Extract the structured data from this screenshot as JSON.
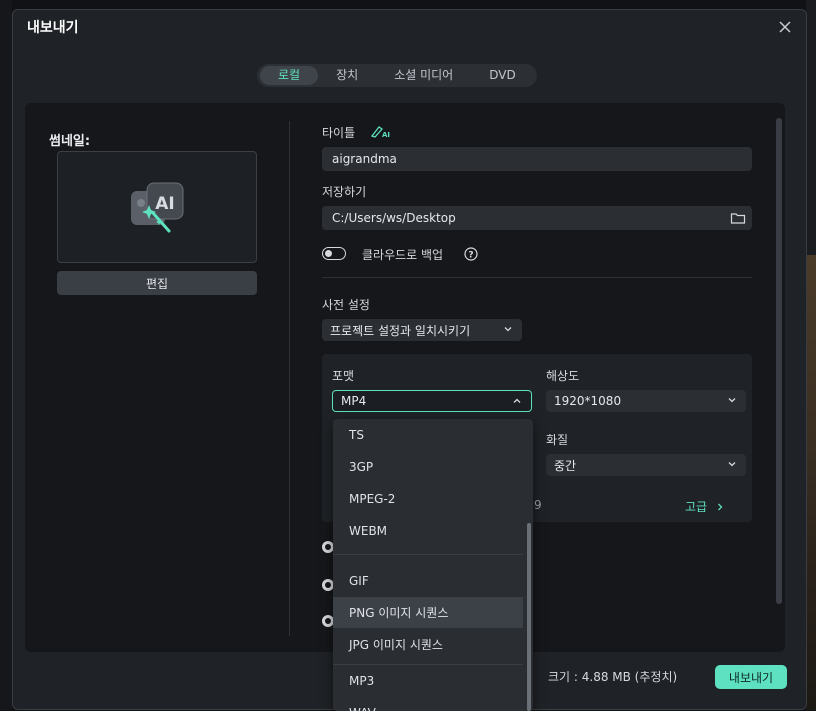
{
  "dialog": {
    "title": "내보내기"
  },
  "tabs": [
    {
      "label": "로컬",
      "active": true
    },
    {
      "label": "장치",
      "active": false
    },
    {
      "label": "소셜 미디어",
      "active": false
    },
    {
      "label": "DVD",
      "active": false
    }
  ],
  "thumbnail": {
    "label": "썸네일:",
    "edit_label": "편집",
    "icon": "ai-image-icon"
  },
  "form": {
    "title_label": "타이틀",
    "title_value": "aigrandma",
    "save_label": "저장하기",
    "save_path": "C:/Users/ws/Desktop",
    "cloud_backup_label": "클라우드로 백업",
    "cloud_backup_on": false,
    "preset_label": "사전 설정",
    "preset_value": "프로젝트 설정과 일치시키기",
    "format_label": "포맷",
    "format_value": "MP4",
    "resolution_label": "해상도",
    "resolution_value": "1920*1080",
    "quality_label": "화질",
    "quality_value": "중간",
    "advanced_label": "고급",
    "partial_text": "9"
  },
  "format_dropdown": {
    "items": [
      "TS",
      "3GP",
      "MPEG-2",
      "WEBM",
      "GIF",
      "PNG 이미지 시퀀스",
      "JPG 이미지 시퀀스",
      "MP3",
      "WAV"
    ],
    "hovered": "PNG 이미지 시퀀스"
  },
  "footer": {
    "size_text": "크기 :  4.88 MB (추정치)",
    "export_label": "내보내기"
  },
  "colors": {
    "accent": "#5ee1c0",
    "background": "#1f2226",
    "panel": "#15171a"
  }
}
